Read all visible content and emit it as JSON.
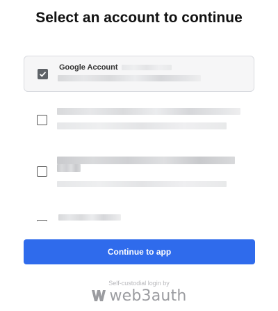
{
  "header": {
    "title": "Select an account to continue"
  },
  "accounts": [
    {
      "label": "Google Account",
      "selected": true
    },
    {
      "label": "",
      "selected": false
    },
    {
      "label": "",
      "selected": false
    },
    {
      "label": "",
      "selected": false
    }
  ],
  "actions": {
    "continue_label": "Continue to app"
  },
  "footer": {
    "note": "Self-custodial login by",
    "brand": "web3auth"
  },
  "colors": {
    "primary": "#2f6bec",
    "selected_bg": "#f6f6f7",
    "checkbox_checked": "#5f6368"
  }
}
